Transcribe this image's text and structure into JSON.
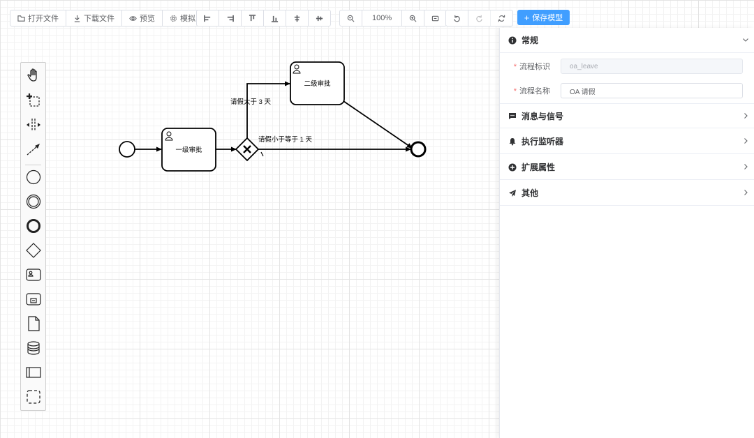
{
  "toolbar": {
    "file_group": [
      "打开文件",
      "下载文件",
      "预览",
      "模拟"
    ],
    "zoom_level": "100%",
    "save_label": "保存模型"
  },
  "palette": {
    "tools": [
      "hand-tool",
      "lasso-tool",
      "space-tool",
      "global-connect-tool"
    ],
    "elements": [
      "start-event",
      "intermediate-event",
      "end-event",
      "gateway",
      "user-task",
      "subprocess",
      "data-object",
      "data-store",
      "pool",
      "group"
    ]
  },
  "diagram": {
    "task1": "一级审批",
    "task2": "二级审批",
    "flow_gt3": "请假大于 3 天",
    "flow_le1": "请假小于等于 1 天"
  },
  "panel": {
    "general": {
      "title": "常规",
      "id_label": "流程标识",
      "id_value": "oa_leave",
      "name_label": "流程名称",
      "name_value": "OA 请假"
    },
    "sections": [
      "消息与信号",
      "执行监听器",
      "扩展属性",
      "其他"
    ]
  },
  "colors": {
    "accent": "#409eff",
    "required": "#f56c6c"
  }
}
